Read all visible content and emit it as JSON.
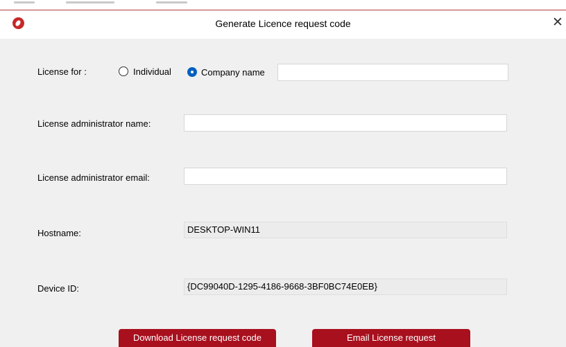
{
  "window": {
    "title": "Generate Licence request code",
    "close_glyph": "✕"
  },
  "form": {
    "license_for_label": "License for :",
    "individual_label": "Individual",
    "company_label": "Company name",
    "selected_option": "company",
    "company_value": "",
    "admin_name_label": "License administrator name:",
    "admin_name_value": "",
    "admin_email_label": "License administrator email:",
    "admin_email_value": "",
    "hostname_label": "Hostname:",
    "hostname_value": "DESKTOP-WIN11",
    "device_id_label": "Device ID:",
    "device_id_value": "{DC99040D-1295-4186-9668-3BF0BC74E0EB}"
  },
  "buttons": {
    "download_label": "Download License request code",
    "email_label": "Email License request"
  },
  "colors": {
    "accent": "#a8101e",
    "radio_selected": "#0060c0"
  },
  "icons": {
    "app": "app-logo-icon",
    "close": "close-icon"
  }
}
